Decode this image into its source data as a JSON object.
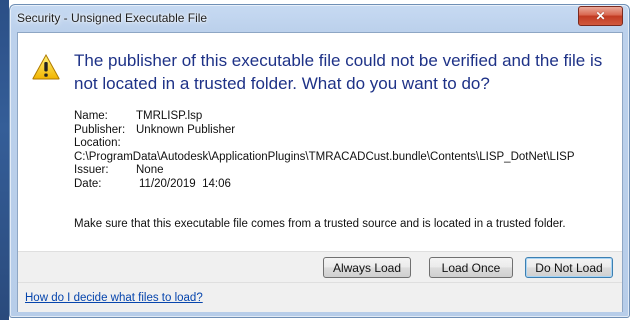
{
  "window": {
    "title": "Security - Unsigned Executable File",
    "close_glyph": "✕"
  },
  "message": {
    "icon": "warning-icon",
    "headline": "The publisher of this executable file could not be verified and the file is not located in a trusted folder. What do you want to do?"
  },
  "details": {
    "name_label": "Name:",
    "name_value": "TMRLISP.lsp",
    "publisher_label": "Publisher:",
    "publisher_value": "Unknown Publisher",
    "location_label": "Location:",
    "location_value": "C:\\ProgramData\\Autodesk\\ApplicationPlugins\\TMRACADCust.bundle\\Contents\\LISP_DotNet\\LISP",
    "issuer_label": "Issuer:",
    "issuer_value": "None",
    "date_label": "Date:",
    "date_value": "11/20/2019  14:06"
  },
  "advice": "Make sure that this executable file comes from a trusted source and is located in a trusted folder.",
  "buttons": {
    "always_load": "Always Load",
    "load_once": "Load Once",
    "do_not_load": "Do Not Load"
  },
  "footer": {
    "help_link": "How do I decide what files to load?"
  },
  "colors": {
    "headline": "#1e3287",
    "link": "#0645ad",
    "close_button": "#c13a22"
  }
}
